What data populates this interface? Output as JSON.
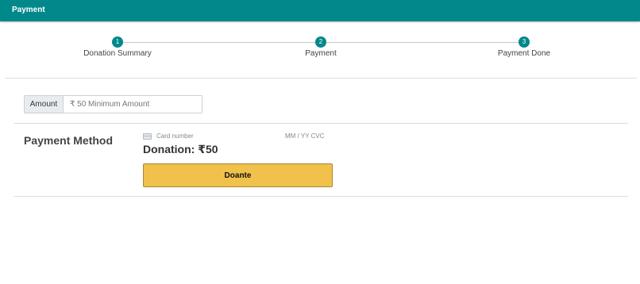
{
  "header": {
    "title": "Payment"
  },
  "stepper": {
    "steps": [
      {
        "number": "1",
        "label": "Donation Summary"
      },
      {
        "number": "2",
        "label": "Payment"
      },
      {
        "number": "3",
        "label": "Payment Done"
      }
    ],
    "active_color": "#00888a"
  },
  "amount": {
    "addon_label": "Amount",
    "placeholder": "₹ 50 Minimum Amount",
    "value": ""
  },
  "payment_method": {
    "title": "Payment Method",
    "card_icon": "credit-card-icon",
    "card_number_placeholder": "Card number",
    "expiry_cvc_placeholder": "MM / YY  CVC",
    "donation_text": "Donation: ₹50",
    "button_label": "Doante",
    "button_color": "#f0c14b"
  },
  "theme": {
    "brand": "#00888a"
  }
}
